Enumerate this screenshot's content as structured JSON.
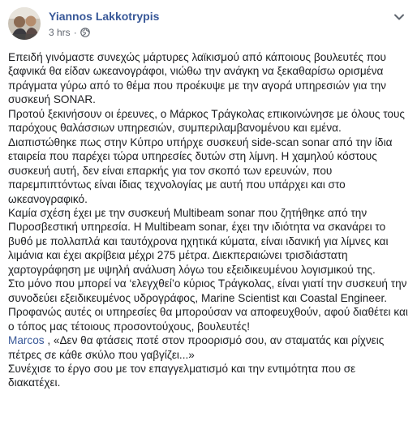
{
  "post": {
    "author": "Yiannos Lakkotrypis",
    "timestamp": "3 hrs",
    "separator": "·",
    "privacy_icon": "globe-icon",
    "more_icon": "chevron-down-icon",
    "paragraphs": [
      "Επειδή γινόμαστε συνεχώς μάρτυρες λαϊκισμού από κάποιους βουλευτές που ξαφνικά θα είδαν ωκεανογράφοι, νιώθω την ανάγκη να ξεκαθαρίσω ορισμένα πράγματα γύρω από το θέμα που προέκυψε με την αγορά υπηρεσιών για την συσκευή SONAR.",
      "Προτού ξεκινήσουν οι έρευνες, ο Μάρκος Τράγκολας επικοινώνησε με όλους τους παρόχους θαλάσσιων υπηρεσιών, συμπεριλαμβανομένου και εμένα.",
      "Διαπιστώθηκε πως στην Κύπρο υπήρχε συσκευή side-scan sonar από την ίδια εταιρεία που παρέχει τώρα υπηρεσίες δυτών στη λίμνη. Η χαμηλού κόστους συσκευή αυτή, δεν είναι επαρκής για τον σκοπό των ερευνών, που παρεμπιπτόντως είναι ίδιας τεχνολογίας με αυτή που υπάρχει και στο ωκεανογραφικό.",
      "Καμία σχέση έχει με την συσκευή Multibeam sonar που ζητήθηκε από την Πυροσβεστική υπηρεσία. Η Multibeam sonar, έχει την ιδιότητα να σκανάρει το βυθό με πολλαπλά και ταυτόχρονα ηχητικά κύματα, είναι ιδανική για λίμνες και λιμάνια και έχει ακρίβεια μέχρι 275 μέτρα. Διεκπεραιώνει τρισδιάστατη χαρτογράφηση με υψηλή ανάλυση λόγω του εξειδικευμένου λογισμικού της.",
      "Στο μόνο που μπορεί να ‘ελεγχθεί’ο κύριος Τράγκολας, είναι γιατί την συσκευή την συνοδεύει εξειδικευμένος υδρογράφος, Marine Scientist και Coastal Engineer.",
      "Προφανώς αυτές οι υπηρεσίες θα μπορούσαν να αποφευχθούν, αφού διαθέτει και ο τόπος μας τέτοιους προσοντούχους, βουλευτές!"
    ],
    "mention": "Marcos",
    "quote": " , «Δεν θα φτάσεις ποτέ στον προορισμό σου, αν σταματάς και ρίχνεις πέτρες σε κάθε σκύλο που γαβγίζει...»",
    "closing": "Συνέχισε το έργο σου με τον επαγγελματισμό και την εντιμότητα που σε διακατέχει."
  }
}
